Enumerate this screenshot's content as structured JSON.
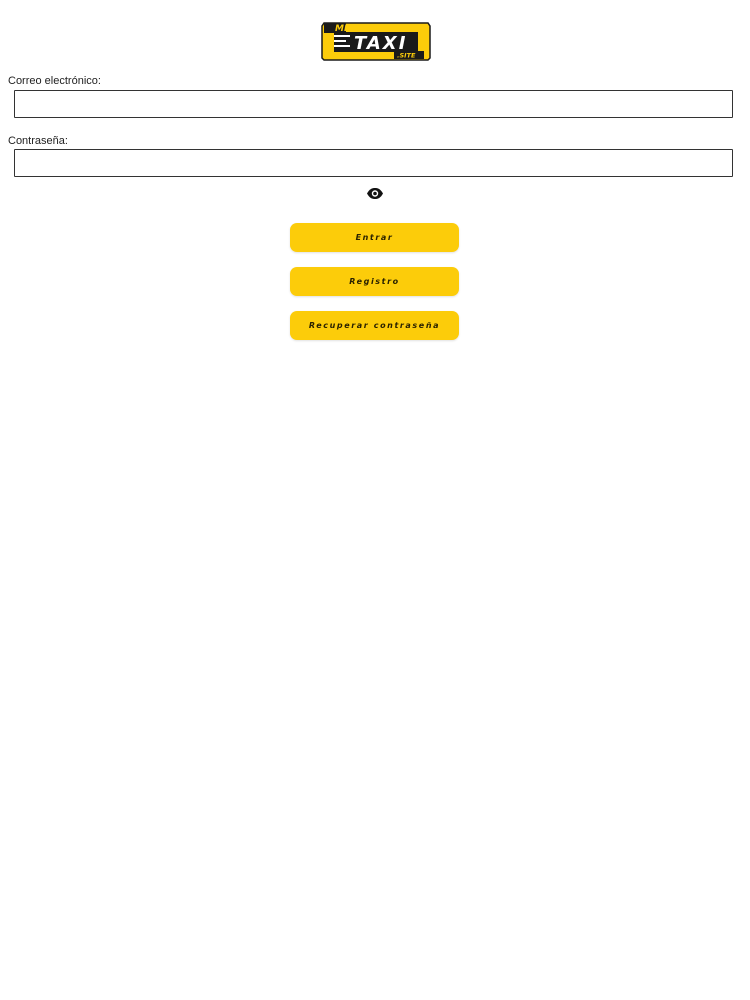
{
  "logo": {
    "top_text": "MI",
    "main_text": "TAXI",
    "bottom_text": ".SITE",
    "brand_yellow": "#fccc0a",
    "brand_dark": "#1a1a1a"
  },
  "form": {
    "email_label": "Correo electrónico:",
    "email_value": "",
    "password_label": "Contraseña:",
    "password_value": "",
    "show_password_icon": "eye-icon"
  },
  "buttons": {
    "enter_label": "Entrar",
    "register_label": "Registro",
    "recover_label": "Recuperar contraseña",
    "color": "#fccc0a"
  }
}
